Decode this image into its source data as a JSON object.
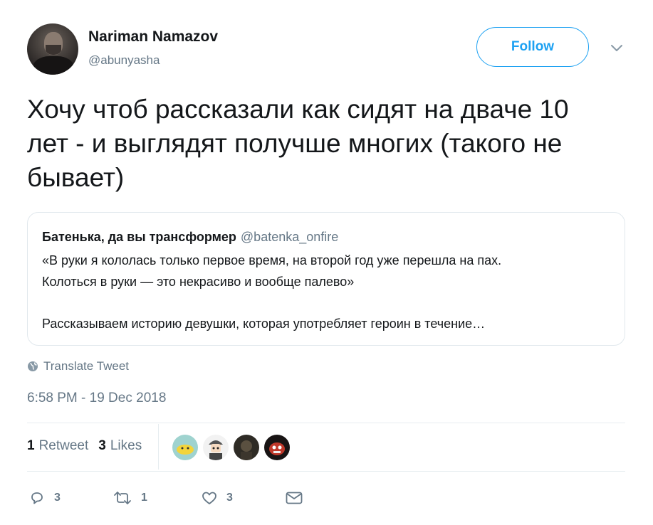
{
  "author": {
    "name": "Nariman Namazov",
    "handle": "@abunyasha"
  },
  "follow_label": "Follow",
  "tweet": {
    "line1": "Хочу чтоб рассказали как сидят на дваче 10",
    "line2": "лет - и выглядят получше многих (такого не",
    "line3": "бывает)"
  },
  "quoted": {
    "name": "Батенька, да вы трансформер",
    "handle": "@batenka_onfire",
    "line1": "«В руки я кололась только первое время, на второй год уже перешла на пах.",
    "line2": "Колоться в руки — это некрасиво и вообще палево»",
    "line3": "Рассказываем историю девушки, которая употребляет героин в течение…"
  },
  "translate_label": "Translate Tweet",
  "timestamp": "6:58 PM - 19 Dec 2018",
  "stats": {
    "retweets_count": "1",
    "retweets_label": "Retweet",
    "likes_count": "3",
    "likes_label": "Likes"
  },
  "actions": {
    "reply_count": "3",
    "retweet_count": "1",
    "like_count": "3"
  },
  "colors": {
    "accent": "#1da1f2",
    "secondary_text": "#657786",
    "border": "#e1e8ed"
  },
  "icons": [
    "chevron-down-icon",
    "globe-icon",
    "reply-icon",
    "retweet-icon",
    "heart-icon",
    "message-icon"
  ]
}
